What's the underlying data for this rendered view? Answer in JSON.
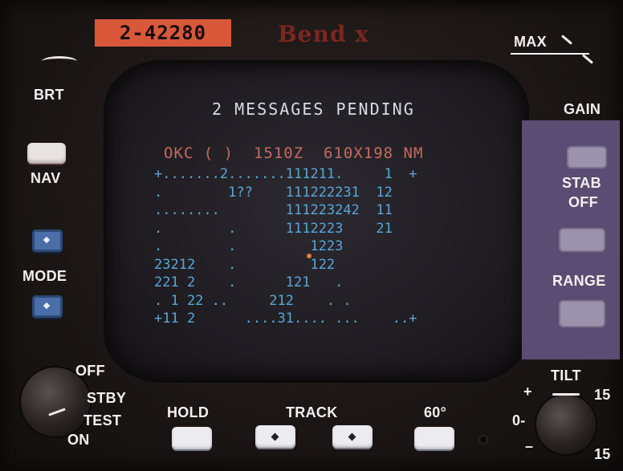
{
  "colors": {
    "bezel": "#1c1716",
    "serial_plate": "#d9583a",
    "crt_text": "#d8dbe4",
    "crt_header": "#c46a62",
    "crt_grid": "#5aa6d8",
    "label": "#f4f0ee",
    "button_blue": "#4a6ea8",
    "panel_overlay": "#5a4c72"
  },
  "header": {
    "serial": "2-42280",
    "brand": "Bend x"
  },
  "left_panel": {
    "brt_label": "BRT",
    "nav_label": "NAV",
    "mode_label": "MODE"
  },
  "power_switch": {
    "off": "OFF",
    "stby": "STBY",
    "test": "TEST",
    "on": "ON"
  },
  "bottom_buttons": {
    "hold": "HOLD",
    "track": "TRACK",
    "sixty": "60°"
  },
  "right_panel": {
    "max": "MAX",
    "gain": "GAIN",
    "stab_off_line1": "STAB",
    "stab_off_line2": "OFF",
    "range": "RANGE",
    "tilt": "TILT",
    "tilt_plus": "+",
    "tilt_zero": "0-",
    "tilt_minus": "–",
    "tilt_15_top": "15",
    "tilt_15_bottom": "15"
  },
  "screen": {
    "title": "2 MESSAGES PENDING",
    "header": "OKC ( )  1510Z  610X198 NM",
    "rows": [
      "+.......2.......111211.     1  +",
      ".        1??    111222231  12",
      "........        111223242  11",
      ".        .      1112223    21",
      ".        .         1223",
      "23212    .         122",
      "221 2    .      121   .",
      ". 1 22 ..     212    . .",
      "+11 2      ....31.... ...    ..+"
    ]
  }
}
